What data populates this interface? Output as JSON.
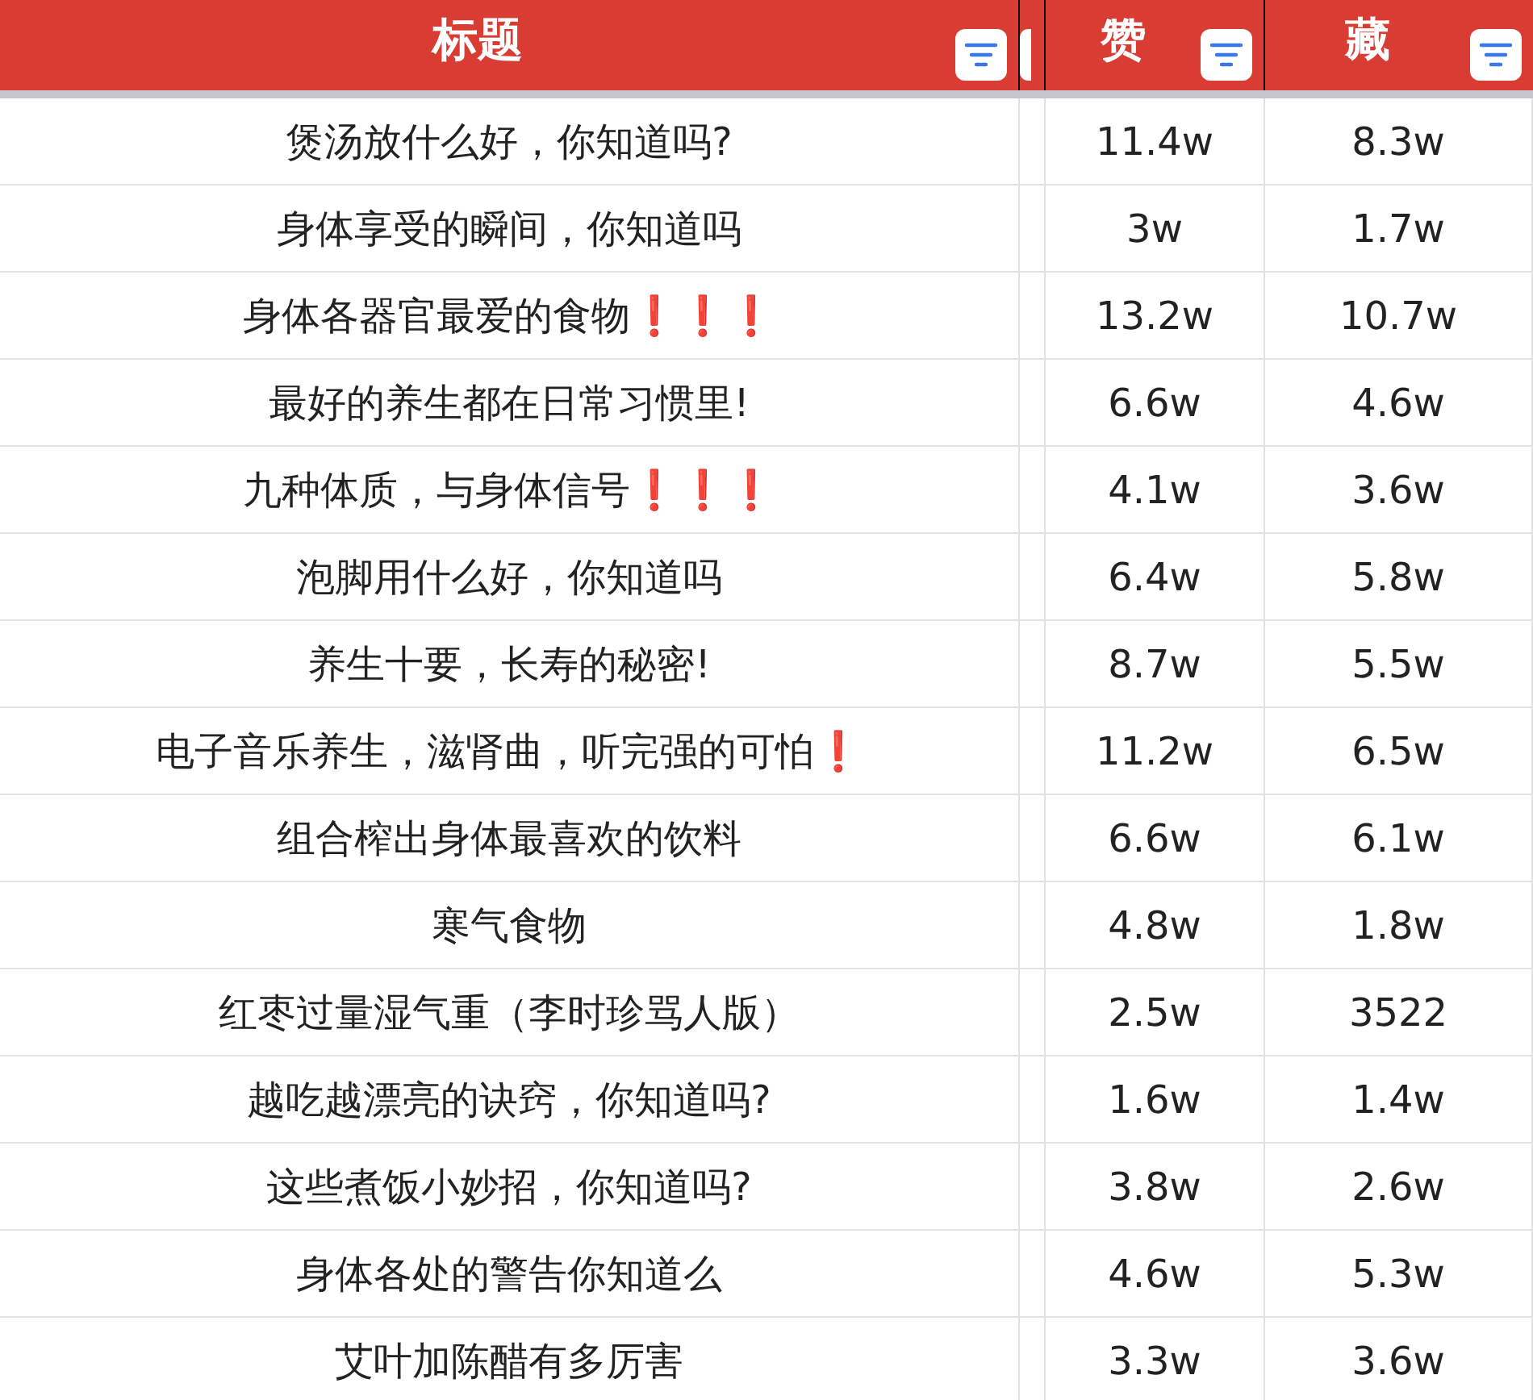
{
  "table": {
    "columns": [
      {
        "kind": "text",
        "label": "标题"
      },
      {
        "kind": "clipped"
      },
      {
        "kind": "text",
        "label": "赞"
      },
      {
        "kind": "text",
        "label": "藏"
      }
    ],
    "rows": [
      {
        "cells": [
          "煲汤放什么好，你知道吗?",
          "",
          "11.4w",
          "8.3w"
        ]
      },
      {
        "cells": [
          "身体享受的瞬间，你知道吗",
          "",
          "3w",
          "1.7w"
        ]
      },
      {
        "cells": [
          "身体各器官最爱的食物❗❗❗",
          "",
          "13.2w",
          "10.7w"
        ]
      },
      {
        "cells": [
          "最好的养生都在日常习惯里!",
          "",
          "6.6w",
          "4.6w"
        ]
      },
      {
        "cells": [
          "九种体质，与身体信号❗❗❗",
          "",
          "4.1w",
          "3.6w"
        ]
      },
      {
        "cells": [
          "泡脚用什么好，你知道吗",
          "",
          "6.4w",
          "5.8w"
        ]
      },
      {
        "cells": [
          "养生十要，长寿的秘密!",
          "",
          "8.7w",
          "5.5w"
        ]
      },
      {
        "cells": [
          "电子音乐养生，滋肾曲，听完强的可怕❗",
          "",
          "11.2w",
          "6.5w"
        ]
      },
      {
        "cells": [
          "组合榨出身体最喜欢的饮料",
          "",
          "6.6w",
          "6.1w"
        ]
      },
      {
        "cells": [
          "寒气食物",
          "",
          "4.8w",
          "1.8w"
        ]
      },
      {
        "cells": [
          "红枣过量湿气重（李时珍骂人版）",
          "",
          "2.5w",
          "3522"
        ]
      },
      {
        "cells": [
          "越吃越漂亮的诀窍，你知道吗?",
          "",
          "1.6w",
          "1.4w"
        ]
      },
      {
        "cells": [
          "这些煮饭小妙招，你知道吗?",
          "",
          "3.8w",
          "2.6w"
        ]
      },
      {
        "cells": [
          "身体各处的警告你知道么",
          "",
          "4.6w",
          "5.3w"
        ]
      },
      {
        "cells": [
          "艾叶加陈醋有多厉害",
          "",
          "3.3w",
          "3.6w"
        ]
      }
    ]
  }
}
